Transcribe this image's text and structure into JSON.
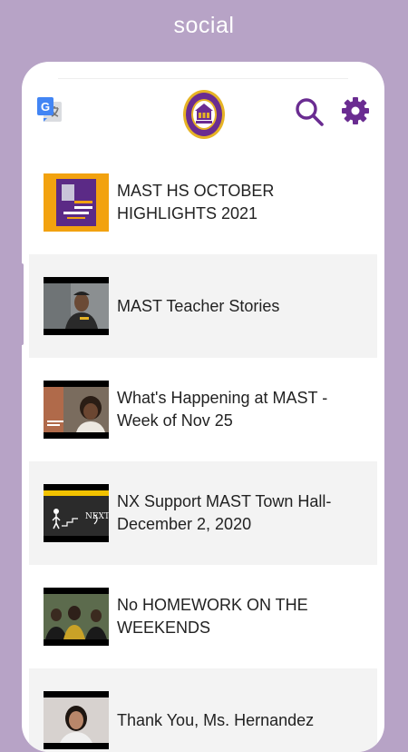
{
  "caption": "social",
  "colors": {
    "background": "#b7a3c6",
    "accent": "#6a2c91",
    "row_alt": "#f3f3f3"
  },
  "header": {
    "left_icon": "google-translate-icon",
    "logo": "school-crest-logo",
    "right_icons": [
      "search-icon",
      "gear-icon"
    ]
  },
  "videos": [
    {
      "title": "MAST HS OCTOBER HIGHLIGHTS 2021"
    },
    {
      "title": "MAST Teacher Stories"
    },
    {
      "title": "What's Happening at MAST - Week of Nov 25"
    },
    {
      "title": "NX Support MAST Town Hall- December 2, 2020"
    },
    {
      "title": "No HOMEWORK ON THE WEEKENDS"
    },
    {
      "title": "Thank You, Ms. Hernandez"
    }
  ]
}
